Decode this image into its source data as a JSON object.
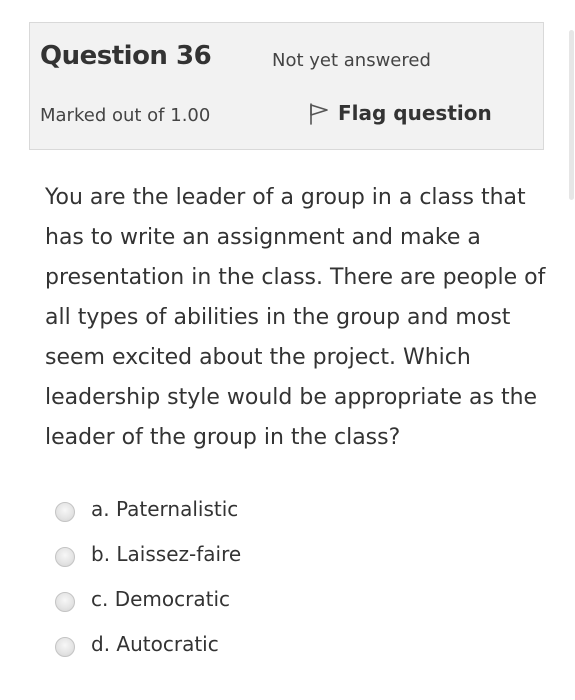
{
  "question": {
    "title": "Question 36",
    "state": "Not yet answered",
    "grade": "Marked out of 1.00",
    "flag_label": "Flag question",
    "text": "You are the leader of a group in a class that has to write an assignment and make a presentation in the class. There are people of all types of abilities in the group and most seem excited about the project. Which leadership style would be appropriate as the leader of the group in the class?"
  },
  "answers": [
    {
      "label": "a. Paternalistic",
      "selected": false
    },
    {
      "label": "b. Laissez-faire",
      "selected": false
    },
    {
      "label": "c. Democratic",
      "selected": false
    },
    {
      "label": "d. Autocratic",
      "selected": false
    }
  ],
  "icons": {
    "flag": "flag-outline-icon",
    "radio": "radio-unchecked-icon"
  },
  "colors": {
    "info_background": "#f2f2f2",
    "info_border": "#d9d9d9",
    "text": "#333333"
  }
}
